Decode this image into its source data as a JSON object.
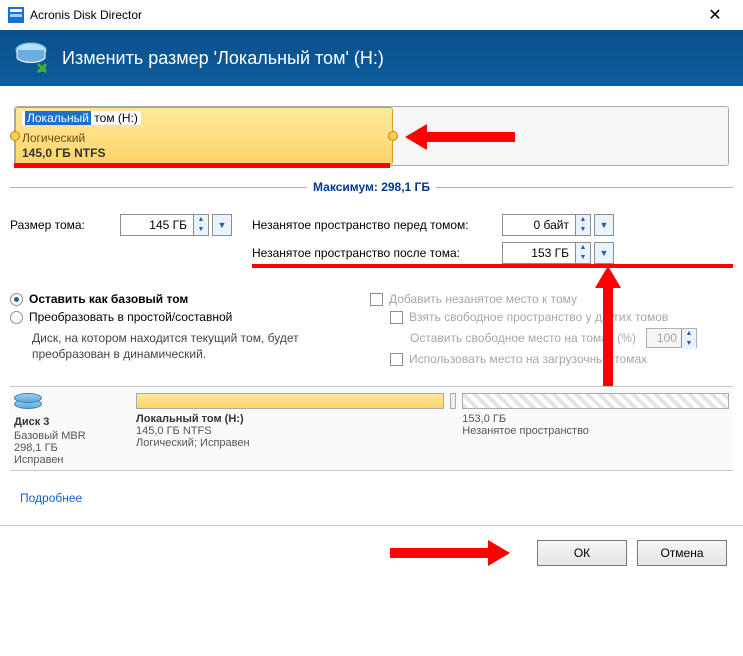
{
  "title": "Acronis Disk Director",
  "ribbon_title": "Изменить размер 'Локальный том' (H:)",
  "volume": {
    "name_hl": "Локальный",
    "name_rest": " том (H:)",
    "type": "Логический",
    "fs": "145,0 ГБ NTFS"
  },
  "maximum_label": "Максимум: 298,1 ГБ",
  "size": {
    "label": "Размер тома:",
    "value": "145 ГБ"
  },
  "free_before": {
    "label": "Незанятое пространство перед томом:",
    "value": "0 байт"
  },
  "free_after": {
    "label": "Незанятое пространство после тома:",
    "value": "153 ГБ"
  },
  "radios": {
    "keep_basic": "Оставить как базовый том",
    "convert": "Преобразовать в простой/составной",
    "note": "Диск, на котором находится текущий том, будет преобразован в динамический."
  },
  "checks": {
    "add_unalloc": "Добавить незанятое место к тому",
    "take_free": "Взять свободное пространство у других томов",
    "leave_free": "Оставить свободное место на томах (%)",
    "leave_free_val": "100",
    "use_boot": "Использовать место на загрузочных томах"
  },
  "disk": {
    "name": "Диск 3",
    "l1": "Базовый MBR",
    "l2": "298,1 ГБ",
    "l3": "Исправен",
    "vol_name": "Локальный том (H:)",
    "vol_l1": "145,0 ГБ NTFS",
    "vol_l2": "Логический; Исправен",
    "free_l1": "153,0 ГБ",
    "free_l2": "Незанятое пространство"
  },
  "more": "Подробнее",
  "btn_ok": "ОК",
  "btn_cancel": "Отмена"
}
